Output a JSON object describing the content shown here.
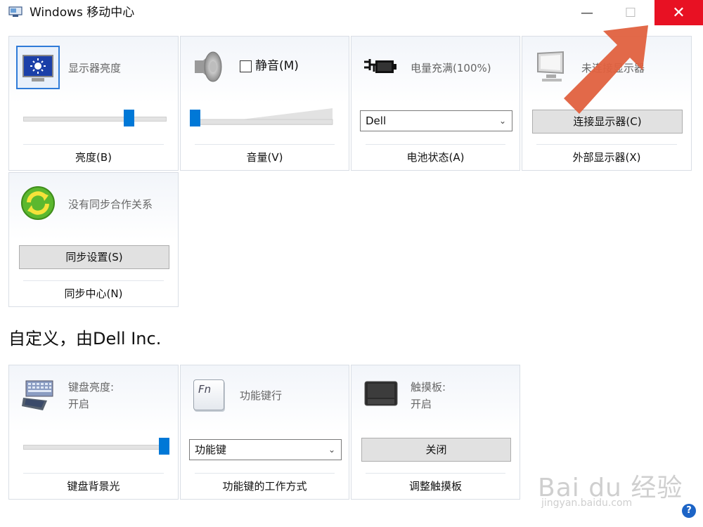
{
  "window": {
    "title": "Windows 移动中心",
    "minimize": "—",
    "maximize": "☐",
    "close": "✕"
  },
  "tiles": {
    "display": {
      "label": "显示器亮度",
      "footer": "亮度(B)",
      "brightness_percent": 75
    },
    "volume": {
      "mute_label": "静音(M)",
      "mute_checked": false,
      "footer": "音量(V)",
      "volume_percent": 0
    },
    "battery": {
      "label": "电量充满(100%)",
      "dropdown_value": "Dell",
      "footer": "电池状态(A)"
    },
    "external_display": {
      "label": "未连接显示器",
      "button": "连接显示器(C)",
      "footer": "外部显示器(X)"
    },
    "sync": {
      "label": "没有同步合作关系",
      "button": "同步设置(S)",
      "footer": "同步中心(N)"
    },
    "keyboard": {
      "label_line1": "键盘亮度:",
      "label_line2": "开启",
      "footer": "键盘背景光",
      "level_percent": 100
    },
    "fn_key": {
      "label": "功能键行",
      "key_glyph": "Fn",
      "dropdown_value": "功能键",
      "footer": "功能键的工作方式"
    },
    "touchpad": {
      "label_line1": "触摸板:",
      "label_line2": "开启",
      "button": "关闭",
      "footer": "调整触摸板"
    }
  },
  "section_header": "自定义，由Dell Inc.",
  "help": "?",
  "watermark": {
    "text": "Bai du 经验",
    "sub": "jingyan.baidu.com"
  },
  "colors": {
    "accent": "#0078d7",
    "close_red": "#e81123",
    "arrow": "#e0613f"
  }
}
